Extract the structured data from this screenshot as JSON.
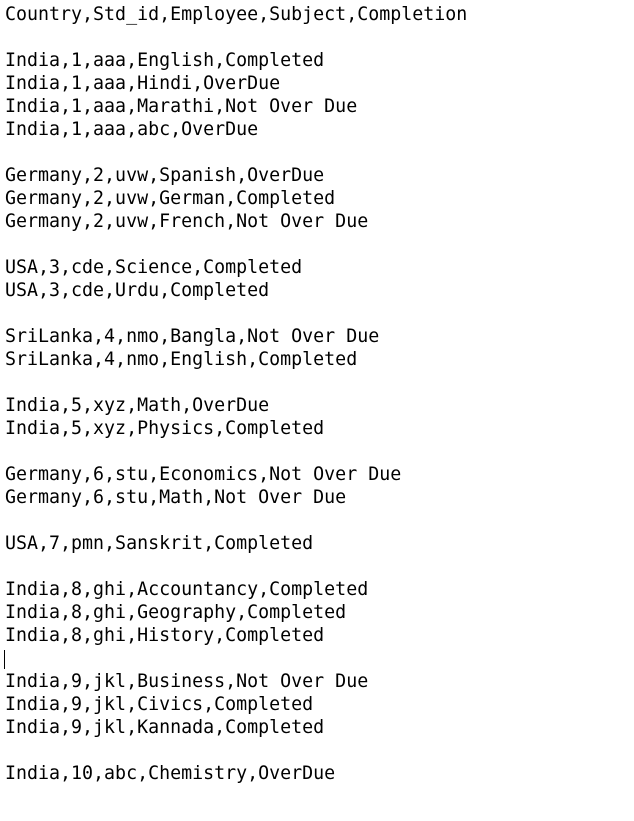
{
  "document": {
    "kind": "plain-text-csv",
    "background_color": "#ffffff",
    "text_color": "#000000",
    "caret": {
      "visible": true,
      "line_index": 28,
      "column": 0
    },
    "header_line": "Country,Std_id,Employee,Subject,Completion",
    "columns": [
      "Country",
      "Std_id",
      "Employee",
      "Subject",
      "Completion"
    ],
    "lines": [
      "Country,Std_id,Employee,Subject,Completion",
      "",
      "India,1,aaa,English,Completed",
      "India,1,aaa,Hindi,OverDue",
      "India,1,aaa,Marathi,Not Over Due",
      "India,1,aaa,abc,OverDue",
      "",
      "Germany,2,uvw,Spanish,OverDue",
      "Germany,2,uvw,German,Completed",
      "Germany,2,uvw,French,Not Over Due",
      "",
      "USA,3,cde,Science,Completed",
      "USA,3,cde,Urdu,Completed",
      "",
      "SriLanka,4,nmo,Bangla,Not Over Due",
      "SriLanka,4,nmo,English,Completed",
      "",
      "India,5,xyz,Math,OverDue",
      "India,5,xyz,Physics,Completed",
      "",
      "Germany,6,stu,Economics,Not Over Due",
      "Germany,6,stu,Math,Not Over Due",
      "",
      "USA,7,pmn,Sanskrit,Completed",
      "",
      "India,8,ghi,Accountancy,Completed",
      "India,8,ghi,Geography,Completed",
      "India,8,ghi,History,Completed",
      "",
      "India,9,jkl,Business,Not Over Due",
      "India,9,jkl,Civics,Completed",
      "India,9,jkl,Kannada,Completed",
      "",
      "India,10,abc,Chemistry,OverDue"
    ],
    "records": [
      {
        "country": "India",
        "std_id": "1",
        "employee": "aaa",
        "subject": "English",
        "completion": "Completed"
      },
      {
        "country": "India",
        "std_id": "1",
        "employee": "aaa",
        "subject": "Hindi",
        "completion": "OverDue"
      },
      {
        "country": "India",
        "std_id": "1",
        "employee": "aaa",
        "subject": "Marathi",
        "completion": "Not Over Due"
      },
      {
        "country": "India",
        "std_id": "1",
        "employee": "aaa",
        "subject": "abc",
        "completion": "OverDue"
      },
      {
        "country": "Germany",
        "std_id": "2",
        "employee": "uvw",
        "subject": "Spanish",
        "completion": "OverDue"
      },
      {
        "country": "Germany",
        "std_id": "2",
        "employee": "uvw",
        "subject": "German",
        "completion": "Completed"
      },
      {
        "country": "Germany",
        "std_id": "2",
        "employee": "uvw",
        "subject": "French",
        "completion": "Not Over Due"
      },
      {
        "country": "USA",
        "std_id": "3",
        "employee": "cde",
        "subject": "Science",
        "completion": "Completed"
      },
      {
        "country": "USA",
        "std_id": "3",
        "employee": "cde",
        "subject": "Urdu",
        "completion": "Completed"
      },
      {
        "country": "SriLanka",
        "std_id": "4",
        "employee": "nmo",
        "subject": "Bangla",
        "completion": "Not Over Due"
      },
      {
        "country": "SriLanka",
        "std_id": "4",
        "employee": "nmo",
        "subject": "English",
        "completion": "Completed"
      },
      {
        "country": "India",
        "std_id": "5",
        "employee": "xyz",
        "subject": "Math",
        "completion": "OverDue"
      },
      {
        "country": "India",
        "std_id": "5",
        "employee": "xyz",
        "subject": "Physics",
        "completion": "Completed"
      },
      {
        "country": "Germany",
        "std_id": "6",
        "employee": "stu",
        "subject": "Economics",
        "completion": "Not Over Due"
      },
      {
        "country": "Germany",
        "std_id": "6",
        "employee": "stu",
        "subject": "Math",
        "completion": "Not Over Due"
      },
      {
        "country": "USA",
        "std_id": "7",
        "employee": "pmn",
        "subject": "Sanskrit",
        "completion": "Completed"
      },
      {
        "country": "India",
        "std_id": "8",
        "employee": "ghi",
        "subject": "Accountancy",
        "completion": "Completed"
      },
      {
        "country": "India",
        "std_id": "8",
        "employee": "ghi",
        "subject": "Geography",
        "completion": "Completed"
      },
      {
        "country": "India",
        "std_id": "8",
        "employee": "ghi",
        "subject": "History",
        "completion": "Completed"
      },
      {
        "country": "India",
        "std_id": "9",
        "employee": "jkl",
        "subject": "Business",
        "completion": "Not Over Due"
      },
      {
        "country": "India",
        "std_id": "9",
        "employee": "jkl",
        "subject": "Civics",
        "completion": "Completed"
      },
      {
        "country": "India",
        "std_id": "9",
        "employee": "jkl",
        "subject": "Kannada",
        "completion": "Completed"
      },
      {
        "country": "India",
        "std_id": "10",
        "employee": "abc",
        "subject": "Chemistry",
        "completion": "OverDue"
      }
    ]
  }
}
